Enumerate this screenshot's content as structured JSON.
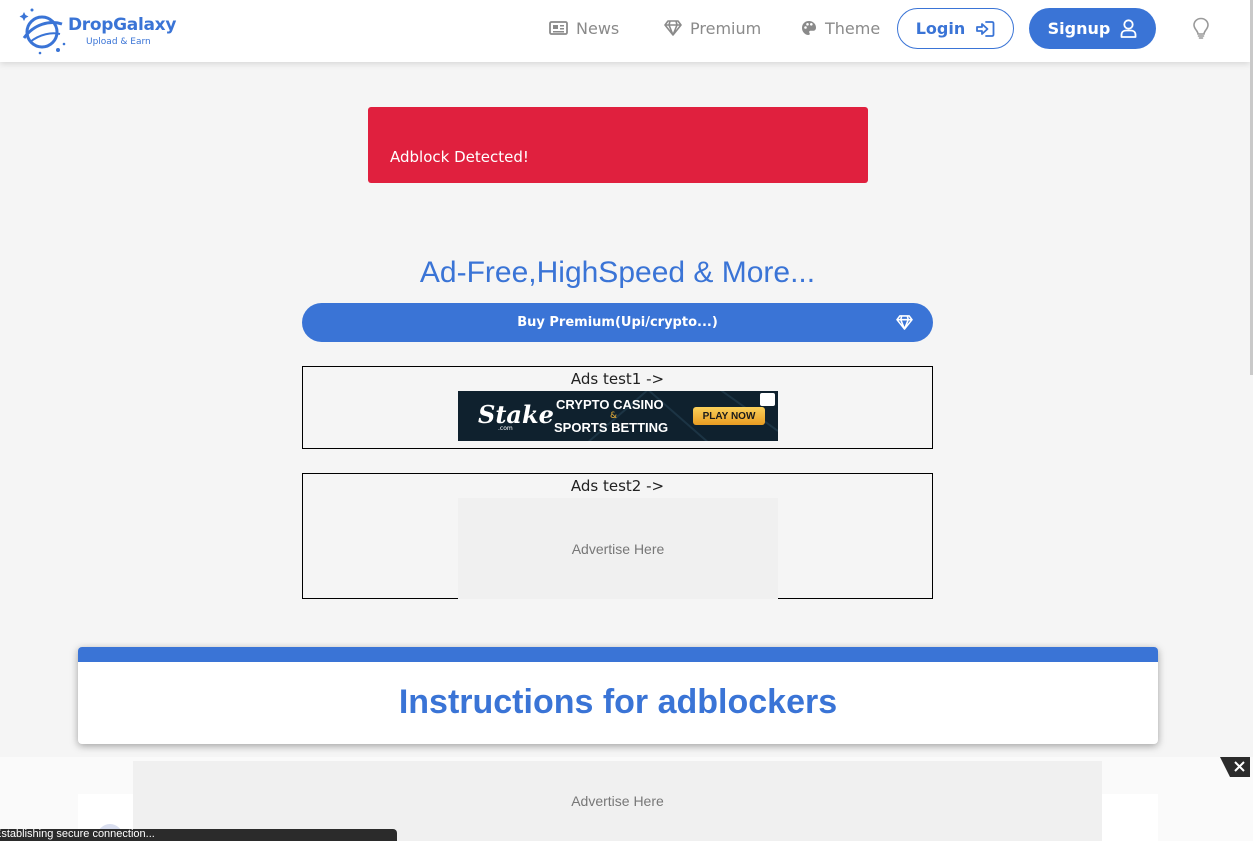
{
  "brand": {
    "name": "DropGalaxy",
    "tagline": "Upload & Earn",
    "color": "#3a74d6"
  },
  "nav": {
    "items": [
      {
        "label": "News",
        "icon": "newspaper-icon"
      },
      {
        "label": "Premium",
        "icon": "diamond-icon"
      },
      {
        "label": "Theme",
        "icon": "palette-icon"
      }
    ],
    "login_label": "Login",
    "signup_label": "Signup",
    "theme_toggle_icon": "lightbulb-icon"
  },
  "alert": {
    "text": "Adblock Detected!",
    "color": "#e0203e"
  },
  "hero": {
    "title": "Ad-Free,HighSpeed & More...",
    "buy_label": "Buy Premium(Upi/crypto...)"
  },
  "ads": {
    "test1_label": "Ads test1 ->",
    "test2_label": "Ads test2 ->",
    "banner": {
      "brand": "Stake",
      "domain": ".com",
      "line1": "CRYPTO CASINO",
      "amp": "&",
      "line2": "SPORTS BETTING",
      "cta": "PLAY NOW"
    },
    "placeholder": "Advertise Here"
  },
  "instructions": {
    "title": "Instructions for adblockers"
  },
  "sticky_ad": {
    "placeholder": "Advertise Here"
  },
  "status": {
    "text": "Establishing secure connection..."
  }
}
